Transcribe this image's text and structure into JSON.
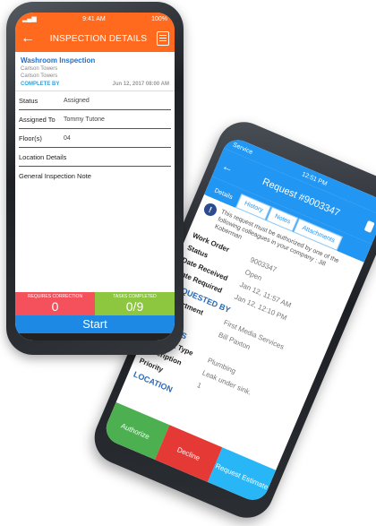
{
  "back_phone": {
    "status": {
      "carrier": "Service",
      "time": "12:51 PM"
    },
    "title": "Request #9003347",
    "tabs": [
      "Details",
      "History",
      "Notes",
      "Attachments"
    ],
    "alert": "This request must be authorized by one of the following colleagues in your company : Jill Koberman",
    "rows": [
      {
        "key": "Work Order",
        "value": "9003347"
      },
      {
        "key": "Status",
        "value": "Open"
      },
      {
        "key": "Date Received",
        "value": "Jan 12, 11:57 AM"
      },
      {
        "key": "Date Required",
        "value": "Jan 12, 12:10 PM"
      }
    ],
    "section_requested_by": "REQUESTED BY",
    "requested_rows": [
      {
        "key": "Department",
        "value": "First Media Services"
      },
      {
        "key": "Name",
        "value": "Bill Paxton"
      }
    ],
    "section_details": "DETAILS",
    "details_rows": [
      {
        "key": "Request Type",
        "value": "Plumbing"
      },
      {
        "key": "Description",
        "value": "Leak under sink."
      },
      {
        "key": "Priority",
        "value": "1"
      }
    ],
    "section_location": "LOCATION",
    "actions": {
      "authorize": "Authorize",
      "decline": "Decline",
      "request_estimate": "Request Estimate"
    }
  },
  "front_phone": {
    "status": {
      "time": "9:41 AM",
      "battery": "100%"
    },
    "title": "INSPECTION DETAILS",
    "card": {
      "name": "Washroom Inspection",
      "line1": "Carlson Towers",
      "line2": "Carlson Towers",
      "complete_by_label": "COMPLETE BY",
      "date": "Jun 12, 2017 08:00 AM"
    },
    "fields": [
      {
        "key": "Status",
        "value": "Assigned"
      },
      {
        "key": "Assigned To",
        "value": "Tommy Tutone"
      },
      {
        "key": "Floor(s)",
        "value": "04"
      }
    ],
    "location_details": "Location Details",
    "general_note": "General Inspection Note",
    "stats": {
      "requires_correction_label": "REQUIRES CORRECTION",
      "requires_correction_value": "0",
      "tasks_completed_label": "TASKS COMPLETED",
      "tasks_completed_value": "0/9"
    },
    "start_label": "Start"
  },
  "colors": {
    "orange": "#ff6a1f",
    "blue": "#1e88e5",
    "red": "#f4515d",
    "green": "#8dc63f"
  }
}
